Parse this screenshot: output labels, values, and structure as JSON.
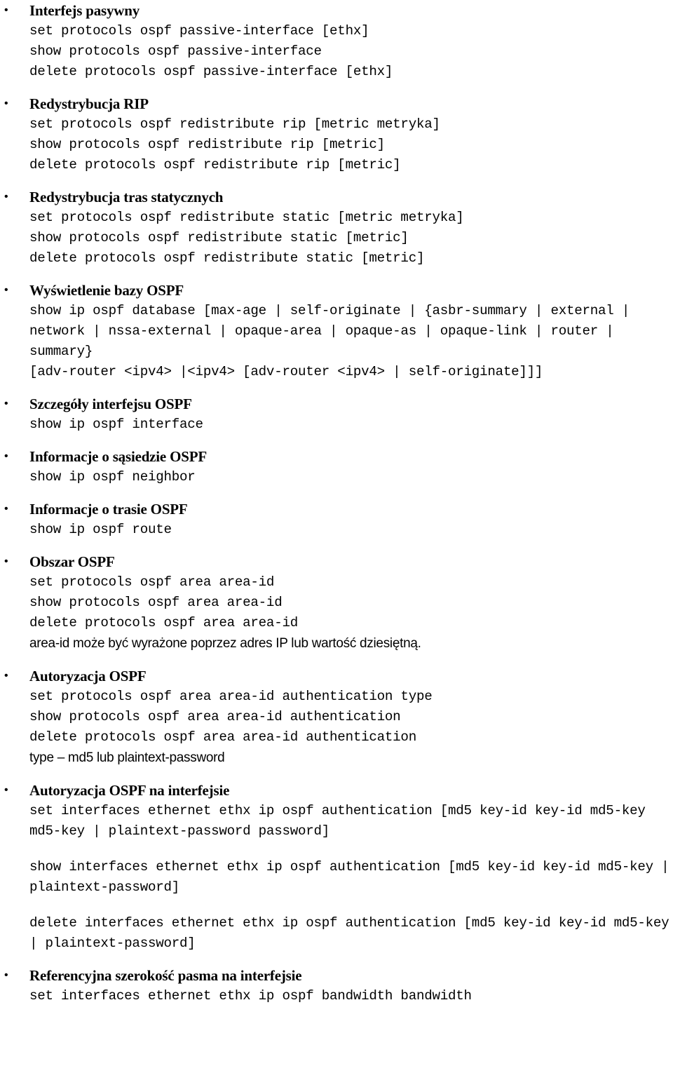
{
  "document": {
    "language": "pl",
    "bullet_glyph": "•",
    "sections": [
      {
        "id": "passive-interface",
        "heading": "Interfejs pasywny",
        "blocks": [
          {
            "type": "cmd",
            "lines": [
              "set protocols ospf passive-interface [ethx]",
              "show protocols ospf passive-interface",
              "delete protocols ospf passive-interface [ethx]"
            ]
          }
        ]
      },
      {
        "id": "redistribute-rip",
        "heading": "Redystrybucja RIP",
        "blocks": [
          {
            "type": "cmd",
            "lines": [
              "set protocols ospf redistribute rip [metric metryka]",
              "show protocols ospf redistribute rip [metric]",
              "delete protocols ospf redistribute rip [metric]"
            ]
          }
        ]
      },
      {
        "id": "redistribute-static",
        "heading": "Redystrybucja tras statycznych",
        "blocks": [
          {
            "type": "cmd",
            "lines": [
              "set protocols ospf redistribute static [metric metryka]",
              "show protocols ospf redistribute static [metric]",
              "delete protocols ospf redistribute static [metric]"
            ]
          }
        ]
      },
      {
        "id": "ospf-database",
        "heading": "Wyświetlenie bazy OSPF",
        "blocks": [
          {
            "type": "cmd",
            "lines": [
              "show ip ospf database [max-age | self-originate | {asbr-summary | external | network | nssa-external | opaque-area | opaque-as | opaque-link | router | summary}",
              "[adv-router <ipv4> |<ipv4> [adv-router <ipv4> | self-originate]]]"
            ]
          }
        ]
      },
      {
        "id": "ospf-interface-details",
        "heading": "Szczegóły interfejsu OSPF",
        "blocks": [
          {
            "type": "cmd",
            "lines": [
              "show ip ospf interface"
            ]
          }
        ]
      },
      {
        "id": "ospf-neighbor",
        "heading": "Informacje o sąsiedzie OSPF",
        "blocks": [
          {
            "type": "cmd",
            "lines": [
              "show ip ospf neighbor"
            ]
          }
        ]
      },
      {
        "id": "ospf-route",
        "heading": "Informacje o trasie OSPF",
        "blocks": [
          {
            "type": "cmd",
            "lines": [
              "show ip ospf route"
            ]
          }
        ]
      },
      {
        "id": "ospf-area",
        "heading": "Obszar OSPF",
        "blocks": [
          {
            "type": "cmd",
            "lines": [
              "set protocols ospf area area-id",
              "show protocols ospf area area-id",
              "delete protocols ospf area area-id"
            ]
          },
          {
            "type": "note",
            "lines": [
              "area-id może być wyrażone poprzez adres IP lub wartość dziesiętną."
            ]
          }
        ]
      },
      {
        "id": "ospf-authorization",
        "heading": "Autoryzacja OSPF",
        "blocks": [
          {
            "type": "cmd",
            "lines": [
              "set protocols ospf area area-id authentication type",
              "show protocols ospf area area-id authentication",
              "delete protocols ospf area area-id authentication"
            ]
          },
          {
            "type": "note",
            "lines": [
              "type – md5 lub plaintext-password"
            ]
          }
        ]
      },
      {
        "id": "ospf-authorization-interface",
        "heading": "Autoryzacja OSPF na interfejsie",
        "blocks": [
          {
            "type": "cmd",
            "lines": [
              "set interfaces ethernet ethx ip ospf authentication [md5 key-id key-id md5-key md5-key | plaintext-password password]"
            ]
          },
          {
            "type": "cmd",
            "spaced": true,
            "lines": [
              "show interfaces ethernet ethx ip ospf authentication [md5 key-id key-id md5-key | plaintext-password]"
            ]
          },
          {
            "type": "cmd",
            "spaced": true,
            "lines": [
              "delete interfaces ethernet ethx ip ospf authentication [md5 key-id key-id md5-key | plaintext-password]"
            ]
          }
        ]
      },
      {
        "id": "reference-bandwidth",
        "heading": "Referencyjna szerokość pasma na interfejsie",
        "blocks": [
          {
            "type": "cmd",
            "lines": [
              "set interfaces ethernet ethx ip ospf bandwidth bandwidth"
            ]
          }
        ]
      }
    ]
  }
}
